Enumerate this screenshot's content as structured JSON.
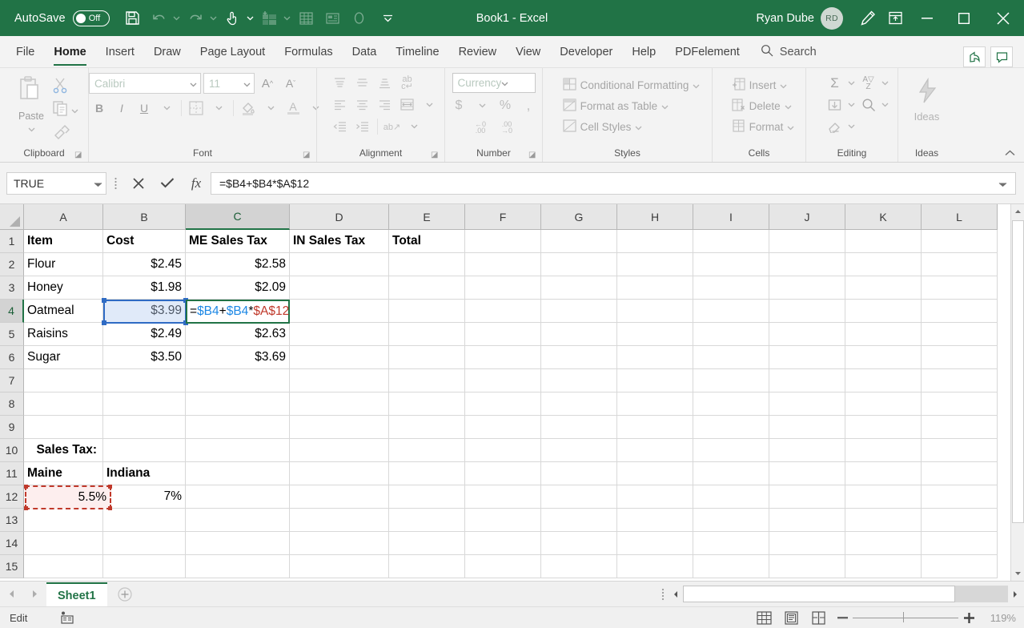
{
  "titlebar": {
    "autosave_label": "AutoSave",
    "autosave_state": "Off",
    "window_title": "Book1  -  Excel",
    "account_name": "Ryan Dube",
    "account_initials": "RD",
    "qat": [
      "save-icon",
      "undo-icon",
      "redo-icon",
      "touch-mode-icon",
      "new-sheet-icon",
      "sort-icon",
      "table-icon",
      "record-icon",
      "customize-qat-icon"
    ],
    "window_buttons": [
      "minimize",
      "maximize",
      "close"
    ]
  },
  "tabs": [
    {
      "label": "File",
      "active": false
    },
    {
      "label": "Home",
      "active": true
    },
    {
      "label": "Insert",
      "active": false
    },
    {
      "label": "Draw",
      "active": false
    },
    {
      "label": "Page Layout",
      "active": false
    },
    {
      "label": "Formulas",
      "active": false
    },
    {
      "label": "Data",
      "active": false
    },
    {
      "label": "Timeline",
      "active": false
    },
    {
      "label": "Review",
      "active": false
    },
    {
      "label": "View",
      "active": false
    },
    {
      "label": "Developer",
      "active": false
    },
    {
      "label": "Help",
      "active": false
    },
    {
      "label": "PDFelement",
      "active": false
    }
  ],
  "search": {
    "label": "Search",
    "icon": "search-icon"
  },
  "ribbon": {
    "clipboard": {
      "label": "Clipboard",
      "paste_label": "Paste",
      "buttons": [
        "cut-icon",
        "copy-icon",
        "format-painter-icon"
      ]
    },
    "font": {
      "label": "Font",
      "font_name": "Calibri",
      "font_size": "11",
      "buttons": [
        "increase-font-size",
        "decrease-font-size",
        "bold",
        "italic",
        "underline",
        "borders",
        "fill-color",
        "font-color"
      ]
    },
    "alignment": {
      "label": "Alignment",
      "buttons": [
        "align-top",
        "align-middle",
        "align-bottom",
        "orientation",
        "align-left",
        "align-center",
        "align-right",
        "wrap-text",
        "decrease-indent",
        "increase-indent",
        "merge-and-center"
      ]
    },
    "number": {
      "label": "Number",
      "format": "Currency",
      "buttons": [
        "accounting-format",
        "percent-style",
        "comma-style",
        "increase-decimal",
        "decrease-decimal"
      ]
    },
    "styles": {
      "label": "Styles",
      "items": [
        "Conditional Formatting",
        "Format as Table",
        "Cell Styles"
      ]
    },
    "cells": {
      "label": "Cells",
      "items": [
        "Insert",
        "Delete",
        "Format"
      ]
    },
    "editing": {
      "label": "Editing",
      "buttons": [
        "autosum-icon",
        "sort-filter-icon",
        "fill-icon",
        "find-select-icon",
        "clear-icon"
      ]
    },
    "ideas": {
      "label": "Ideas",
      "button_label": "Ideas",
      "icon": "lightbulb-icon"
    }
  },
  "formula_bar": {
    "name_box_value": "TRUE",
    "cancel_icon": "cancel-icon",
    "enter_icon": "enter-icon",
    "function_icon": "insert-function-icon",
    "formula_value": "=$B4+$B4*$A$12",
    "expand_icon": "expand-formula-bar-icon"
  },
  "grid": {
    "columns": [
      "A",
      "B",
      "C",
      "D",
      "E",
      "F",
      "G",
      "H",
      "I",
      "J",
      "K",
      "L"
    ],
    "selected_column": "C",
    "selected_row": 4,
    "rows": [
      1,
      2,
      3,
      4,
      5,
      6,
      7,
      8,
      9,
      10,
      11,
      12,
      13,
      14,
      15
    ],
    "cells": {
      "A1": "Item",
      "B1": "Cost",
      "C1": "ME Sales Tax",
      "D1": "IN Sales Tax",
      "E1": "Total",
      "A2": "Flour",
      "B2": "$2.45",
      "C2": "$2.58",
      "A3": "Honey",
      "B3": "$1.98",
      "C3": "$2.09",
      "A4": "Oatmeal",
      "B4": "$3.99",
      "A5": "Raisins",
      "B5": "$2.49",
      "C5": "$2.63",
      "A6": "Sugar",
      "B6": "$3.50",
      "C6": "$3.69",
      "A10": "Sales Tax:",
      "A11": "Maine",
      "B11": "Indiana",
      "A12": "5.5%",
      "B12": "7%"
    },
    "editing_cell": "C4",
    "editing_tokens": [
      {
        "text": "=",
        "color": "black"
      },
      {
        "text": "$B4",
        "color": "blue"
      },
      {
        "text": "+",
        "color": "black"
      },
      {
        "text": "$B4",
        "color": "blue"
      },
      {
        "text": "*",
        "color": "black"
      },
      {
        "text": "$",
        "color": "red"
      },
      {
        "text": "A$12",
        "color": "red"
      }
    ],
    "referenced_cell": "A12",
    "copy_source_cell": "B4"
  },
  "sheet_bar": {
    "prev_icon": "prev-sheet-icon",
    "next_icon": "next-sheet-icon",
    "sheets": [
      "Sheet1"
    ],
    "active_sheet": "Sheet1",
    "add_sheet_icon": "add-sheet-icon"
  },
  "status_bar": {
    "mode": "Edit",
    "accessibility_icon": "accessibility-icon",
    "views": [
      "normal-view-icon",
      "page-layout-view-icon",
      "page-break-preview-icon"
    ],
    "zoom_out_icon": "zoom-out-icon",
    "zoom_in_icon": "zoom-in-icon",
    "zoom_level": "119%"
  },
  "colors": {
    "brand_green": "#217346",
    "ribbon_bg": "#f3f3f3",
    "selection_blue": "#2f6bc4",
    "reference_red": "#c0392b",
    "reference_blue": "#1e88e5"
  }
}
